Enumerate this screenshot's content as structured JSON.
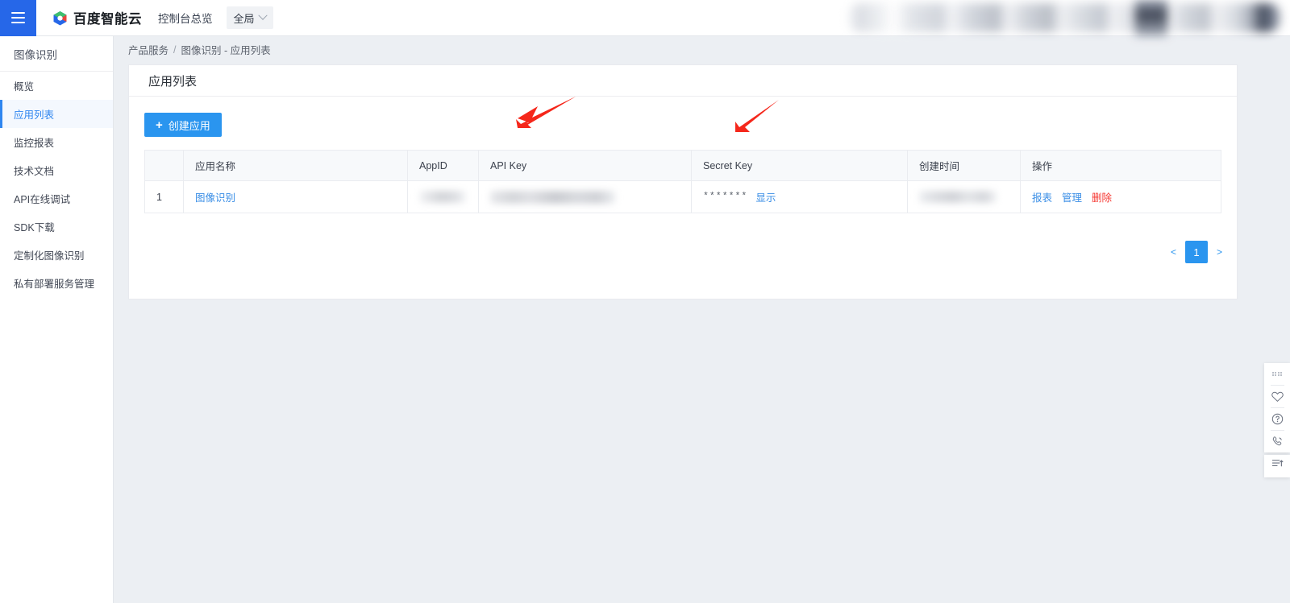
{
  "header": {
    "menu_icon": "hamburger-icon",
    "brand": "百度智能云",
    "console_title": "控制台总览",
    "scope": "全局",
    "scope_chevron": "chevron-down-icon"
  },
  "sidebar": {
    "title": "图像识别",
    "items": [
      {
        "label": "概览",
        "active": false
      },
      {
        "label": "应用列表",
        "active": true
      },
      {
        "label": "监控报表",
        "active": false
      },
      {
        "label": "技术文档",
        "active": false
      },
      {
        "label": "API在线调试",
        "active": false
      },
      {
        "label": "SDK下载",
        "active": false
      },
      {
        "label": "定制化图像识别",
        "active": false
      },
      {
        "label": "私有部署服务管理",
        "active": false
      }
    ]
  },
  "breadcrumb": {
    "root": "产品服务",
    "separator": "/",
    "current": "图像识别 - 应用列表"
  },
  "card": {
    "title": "应用列表",
    "create_button": {
      "icon": "plus-icon",
      "label": "创建应用"
    }
  },
  "table": {
    "columns": [
      "",
      "应用名称",
      "AppID",
      "API Key",
      "Secret Key",
      "创建时间",
      "操作"
    ],
    "rows": [
      {
        "index": "1",
        "name": "图像识别",
        "appid": "",
        "api_key": "",
        "secret_mask": "*******",
        "secret_show_label": "显示",
        "created": "",
        "actions": [
          {
            "label": "报表",
            "style": "link"
          },
          {
            "label": "管理",
            "style": "link"
          },
          {
            "label": "删除",
            "style": "danger"
          }
        ]
      }
    ]
  },
  "pagination": {
    "prev": "<",
    "current_page": "1",
    "next": ">"
  },
  "float_toolbar": {
    "items": [
      {
        "icon": "drag-dots-icon"
      },
      {
        "icon": "heart-icon"
      },
      {
        "icon": "question-mark-icon"
      },
      {
        "icon": "phone-icon"
      }
    ],
    "bottom_item": {
      "icon": "scroll-to-top-icon"
    }
  },
  "annotations": [
    {
      "name": "arrow-api-key",
      "color": "#f5271b"
    },
    {
      "name": "arrow-secret-key",
      "color": "#f5271b"
    }
  ],
  "colors": {
    "accent_blue": "#2a95ef",
    "brand_blue": "#2667e8",
    "danger_red": "#f5342e",
    "page_bg": "#eceff3"
  }
}
